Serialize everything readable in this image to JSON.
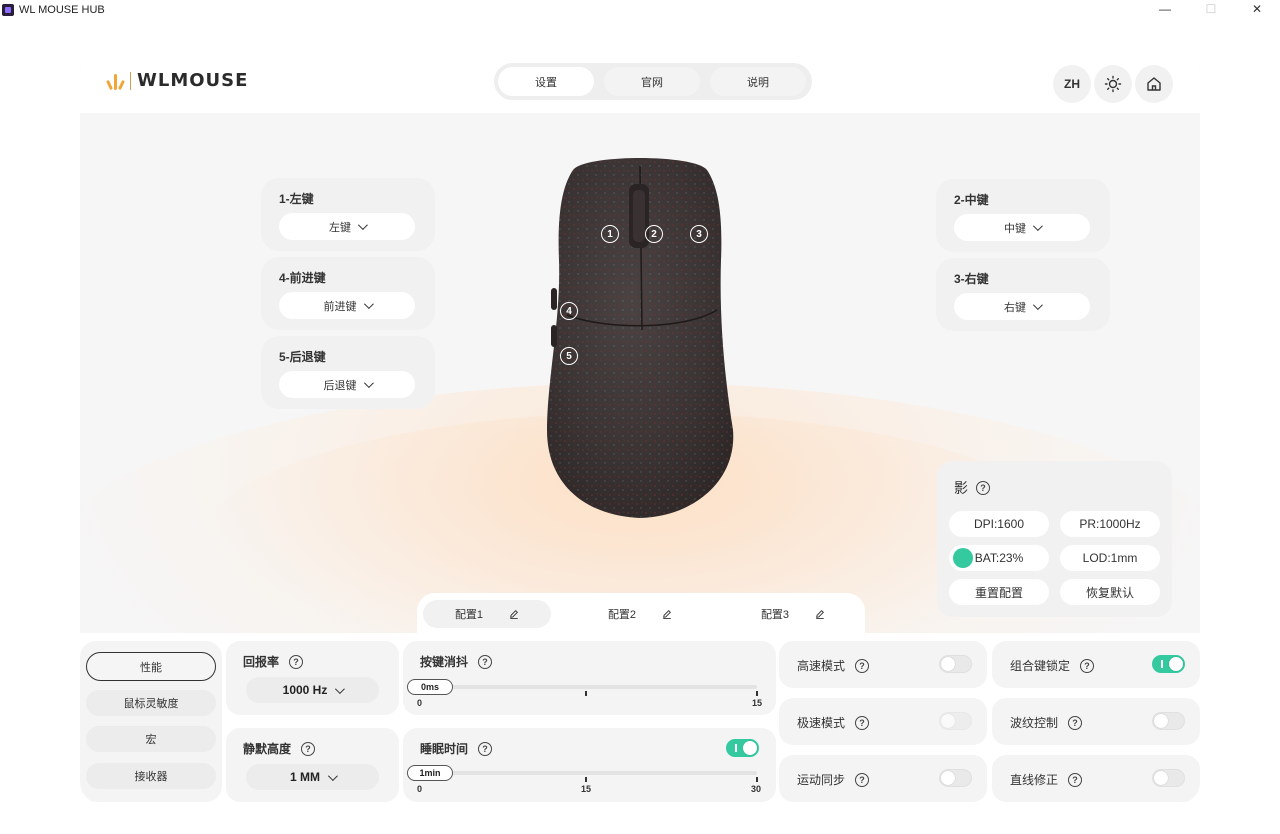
{
  "window": {
    "title": "WL MOUSE HUB",
    "minimize": "—",
    "maximize": "☐",
    "close": "✕"
  },
  "header": {
    "logo_text": "WLMOUSE",
    "tabs": [
      {
        "label": "设置"
      },
      {
        "label": "官网"
      },
      {
        "label": "说明"
      }
    ],
    "lang": "ZH"
  },
  "keys": {
    "k1": {
      "label": "1-左键",
      "value": "左键"
    },
    "k4": {
      "label": "4-前进键",
      "value": "前进键"
    },
    "k5": {
      "label": "5-后退键",
      "value": "后退键"
    },
    "k2": {
      "label": "2-中键",
      "value": "中键"
    },
    "k3": {
      "label": "3-右键",
      "value": "右键"
    }
  },
  "mouse_badges": [
    "1",
    "2",
    "3",
    "4",
    "5"
  ],
  "info": {
    "title": "影",
    "dpi": "DPI:1600",
    "pr": "PR:1000Hz",
    "bat": "BAT:23%",
    "battery_level": 0.23,
    "lod": "LOD:1mm",
    "reset_profile": "重置配置",
    "restore_default": "恢复默认"
  },
  "profiles": [
    {
      "label": "配置1"
    },
    {
      "label": "配置2"
    },
    {
      "label": "配置3"
    }
  ],
  "sidebar": [
    {
      "label": "性能"
    },
    {
      "label": "鼠标灵敏度"
    },
    {
      "label": "宏"
    },
    {
      "label": "接收器"
    }
  ],
  "settings": {
    "polling": {
      "label": "回报率",
      "value": "1000 Hz"
    },
    "lift": {
      "label": "静默高度",
      "value": "1 MM"
    },
    "debounce": {
      "label": "按键消抖",
      "value": "0ms",
      "min": "0",
      "max": "15"
    },
    "sleep": {
      "label": "睡眠时间",
      "value": "1min",
      "min": "0",
      "mid": "15",
      "max": "30",
      "enabled": true
    },
    "high_speed": {
      "label": "高速模式",
      "enabled": false
    },
    "ultra_speed": {
      "label": "极速模式",
      "enabled": false
    },
    "motion_sync": {
      "label": "运动同步",
      "enabled": false
    },
    "combo_lock": {
      "label": "组合键锁定",
      "enabled": true
    },
    "ripple": {
      "label": "波纹控制",
      "enabled": false
    },
    "angle_snap": {
      "label": "直线修正",
      "enabled": false
    }
  },
  "help_glyph": "?",
  "colors": {
    "accent": "#35c9a0",
    "logo": "#f1a63a"
  }
}
